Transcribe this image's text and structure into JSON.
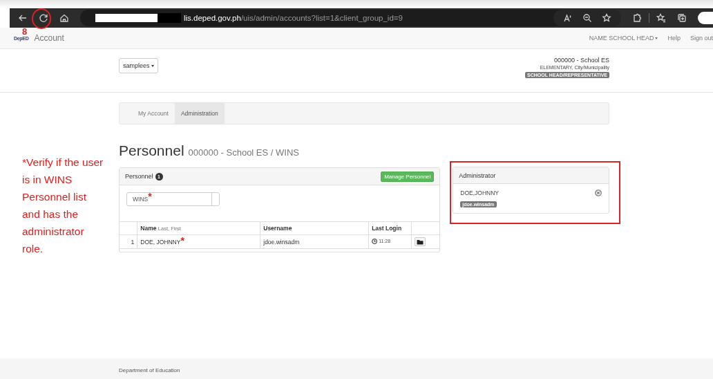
{
  "browser": {
    "url_host": "lis.deped.gov.ph",
    "url_path": "/uis/admin/accounts?list=1&client_group_id=9"
  },
  "navbar": {
    "logo": "DepED",
    "brand": "Account",
    "user_menu": "NAME SCHOOL HEAD",
    "links": [
      "Help",
      "Sign out"
    ]
  },
  "header": {
    "account_menu": "samplees",
    "school": "000000 - School ES",
    "school_type": "ELEMENTARY, City/Municipality",
    "role_badge": "SCHOOL HEAD/REPRESENTATIVE"
  },
  "tabs": [
    {
      "label": "My Account",
      "selected": false
    },
    {
      "label": "Administration",
      "selected": true
    }
  ],
  "page_title": "Personnel",
  "page_subtitle": "000000 - School ES / WINS",
  "personnel_panel": {
    "title": "Personnel",
    "count": "1",
    "action": "Manage Personnel",
    "filter": {
      "value": "WINS",
      "mark": "*"
    },
    "columns": [
      {
        "label": "Name",
        "hint": "Last, First"
      },
      {
        "label": "Username"
      },
      {
        "label": "Last Login"
      }
    ],
    "rows": [
      {
        "index": "1",
        "name": "DOE, JOHNNY",
        "mark": "*",
        "username": "jdoe.winsadm",
        "last_login": "11:28"
      }
    ]
  },
  "admin_panel": {
    "title": "Administrator",
    "items": [
      {
        "name": "DOE,JOHNNY",
        "username": "jdoe.winsadm"
      }
    ]
  },
  "annotations": {
    "step": "8",
    "note": "*Verify if the user is in WINS Personnel list and has the administrator role."
  },
  "footer": "Department of Education"
}
